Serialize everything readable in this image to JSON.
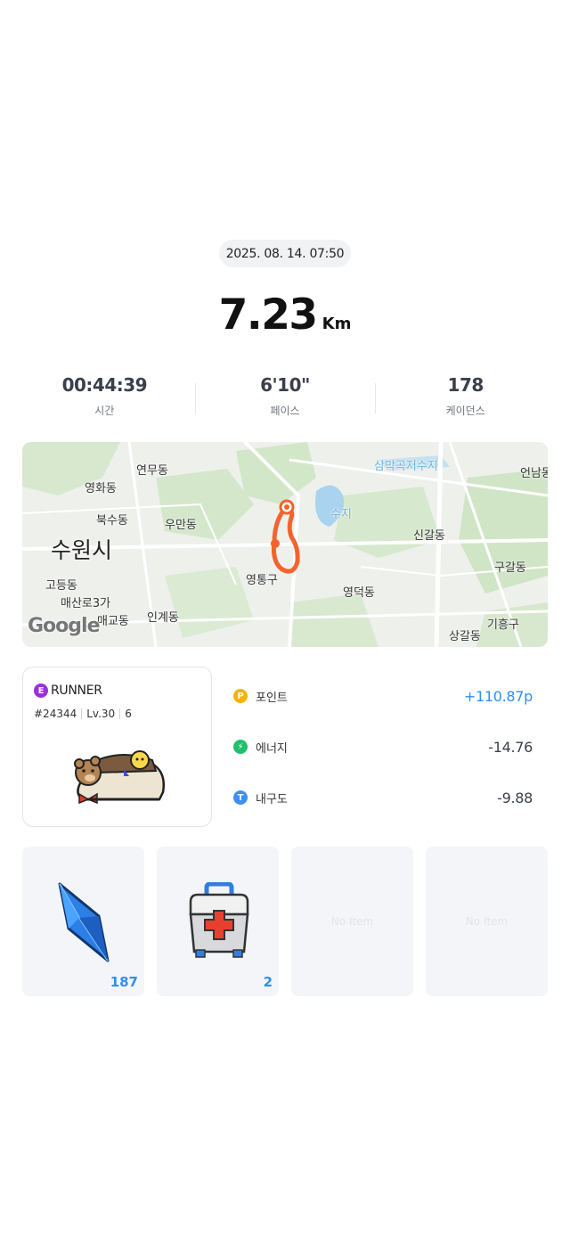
{
  "activity": {
    "datetime": "2025. 08. 14. 07:50",
    "distance": "7.23",
    "distance_unit": "Km"
  },
  "stats": [
    {
      "value": "00:44:39",
      "label": "시간"
    },
    {
      "value": "6'10\"",
      "label": "페이스"
    },
    {
      "value": "178",
      "label": "케이던스"
    }
  ],
  "map": {
    "labels": {
      "yeonmudong": "연무동",
      "yeonghwadong": "영화동",
      "buksudong": "북수동",
      "umandong": "우만동",
      "suwonsi": "수원시",
      "godeungdong": "고등동",
      "maesanro": "매산로3가",
      "maegyodong": "매교동",
      "ingyedong": "인계동",
      "yeongtonggu": "영통구",
      "yeongdeokdong": "영덕동",
      "singaldong": "신갈동",
      "gugaldong": "구갈동",
      "giheunggu": "기흥구",
      "sanggaldong": "상갈동",
      "eonnamdong": "언남동",
      "reservoir": "삼막곡저수지",
      "reservoir2": "수지"
    },
    "attribution": "Google",
    "route_color": "#f4622e"
  },
  "nft": {
    "type_badge": "E",
    "type_label": "RUNNER",
    "id": "#24344",
    "level": "Lv.30",
    "mint": "6"
  },
  "rewards": [
    {
      "icon": "P",
      "label": "포인트",
      "value": "+110.87p",
      "color": "#f5b300"
    },
    {
      "icon": "⚡",
      "label": "에너지",
      "value": "-14.76",
      "color": "#21c06b"
    },
    {
      "icon": "T",
      "label": "내구도",
      "value": "-9.88",
      "color": "#3d8ff0"
    }
  ],
  "items": [
    {
      "name": "gem",
      "count": "187"
    },
    {
      "name": "first-aid-kit",
      "count": "2"
    },
    {
      "empty": "No Item"
    },
    {
      "empty": "No Item"
    }
  ]
}
